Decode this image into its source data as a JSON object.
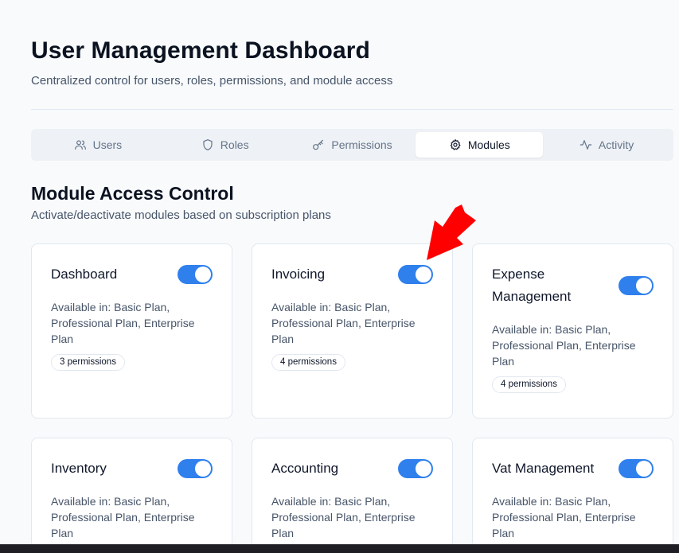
{
  "header": {
    "title": "User Management Dashboard",
    "subtitle": "Centralized control for users, roles, permissions, and module access"
  },
  "tabs": [
    {
      "label": "Users",
      "icon": "users-icon",
      "active": false
    },
    {
      "label": "Roles",
      "icon": "shield-icon",
      "active": false
    },
    {
      "label": "Permissions",
      "icon": "key-icon",
      "active": false
    },
    {
      "label": "Modules",
      "icon": "gear-icon",
      "active": true
    },
    {
      "label": "Activity",
      "icon": "activity-icon",
      "active": false
    }
  ],
  "section": {
    "title": "Module Access Control",
    "subtitle": "Activate/deactivate modules based on subscription plans"
  },
  "modules": [
    {
      "name": "Dashboard",
      "enabled": true,
      "available": "Available in: Basic Plan, Professional Plan, Enterprise Plan",
      "permissions": "3 permissions"
    },
    {
      "name": "Invoicing",
      "enabled": true,
      "available": "Available in: Basic Plan, Professional Plan, Enterprise Plan",
      "permissions": "4 permissions"
    },
    {
      "name": "Expense Management",
      "enabled": true,
      "available": "Available in: Basic Plan, Professional Plan, Enterprise Plan",
      "permissions": "4 permissions"
    },
    {
      "name": "Inventory",
      "enabled": true,
      "available": "Available in: Basic Plan, Professional Plan, Enterprise Plan",
      "permissions": ""
    },
    {
      "name": "Accounting",
      "enabled": true,
      "available": "Available in: Basic Plan, Professional Plan, Enterprise Plan",
      "permissions": ""
    },
    {
      "name": "Vat Management",
      "enabled": true,
      "available": "Available in: Basic Plan, Professional Plan, Enterprise Plan",
      "permissions": ""
    }
  ],
  "colors": {
    "toggle_on": "#2f80ed",
    "annotation_arrow": "#ff0000"
  }
}
